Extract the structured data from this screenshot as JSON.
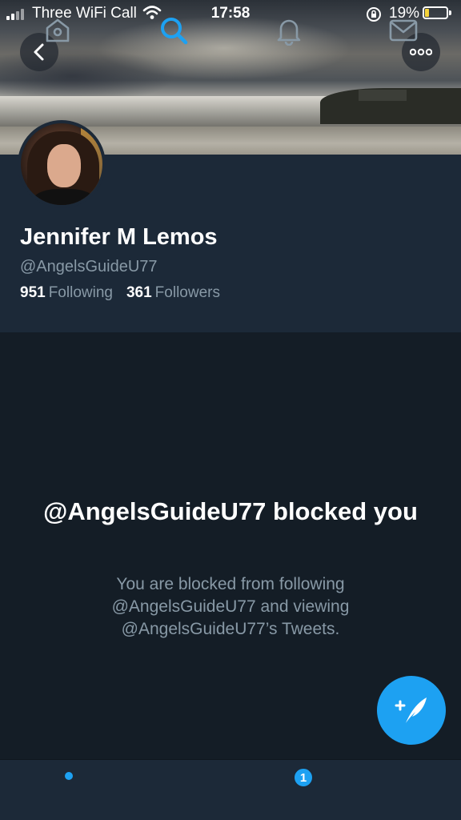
{
  "status_bar": {
    "carrier": "Three WiFi Call",
    "time": "17:58",
    "battery_percent": "19%",
    "battery_level": 0.19,
    "battery_color": "#f5d33a"
  },
  "header": {
    "back_icon": "chevron-left-icon",
    "more_icon": "ellipsis-icon"
  },
  "profile": {
    "name": "Jennifer M Lemos",
    "handle": "@AngelsGuideU77",
    "following_count": "951",
    "following_label": "Following",
    "followers_count": "361",
    "followers_label": "Followers"
  },
  "blocked": {
    "title": "@AngelsGuideU77 blocked you",
    "description": "You are blocked from following @AngelsGuideU77 and viewing @AngelsGuideU77’s Tweets."
  },
  "fab": {
    "icon": "compose-tweet-icon"
  },
  "tabbar": {
    "tabs": [
      {
        "name": "home",
        "icon": "home-icon",
        "active": false,
        "has_dot": true
      },
      {
        "name": "search",
        "icon": "search-icon",
        "active": true
      },
      {
        "name": "notifications",
        "icon": "bell-icon",
        "active": false,
        "badge": "1"
      },
      {
        "name": "messages",
        "icon": "envelope-icon",
        "active": false
      }
    ]
  },
  "colors": {
    "accent": "#1da1f2",
    "background": "#141d26",
    "panel": "#1c2938",
    "secondary_text": "#8899a6"
  }
}
